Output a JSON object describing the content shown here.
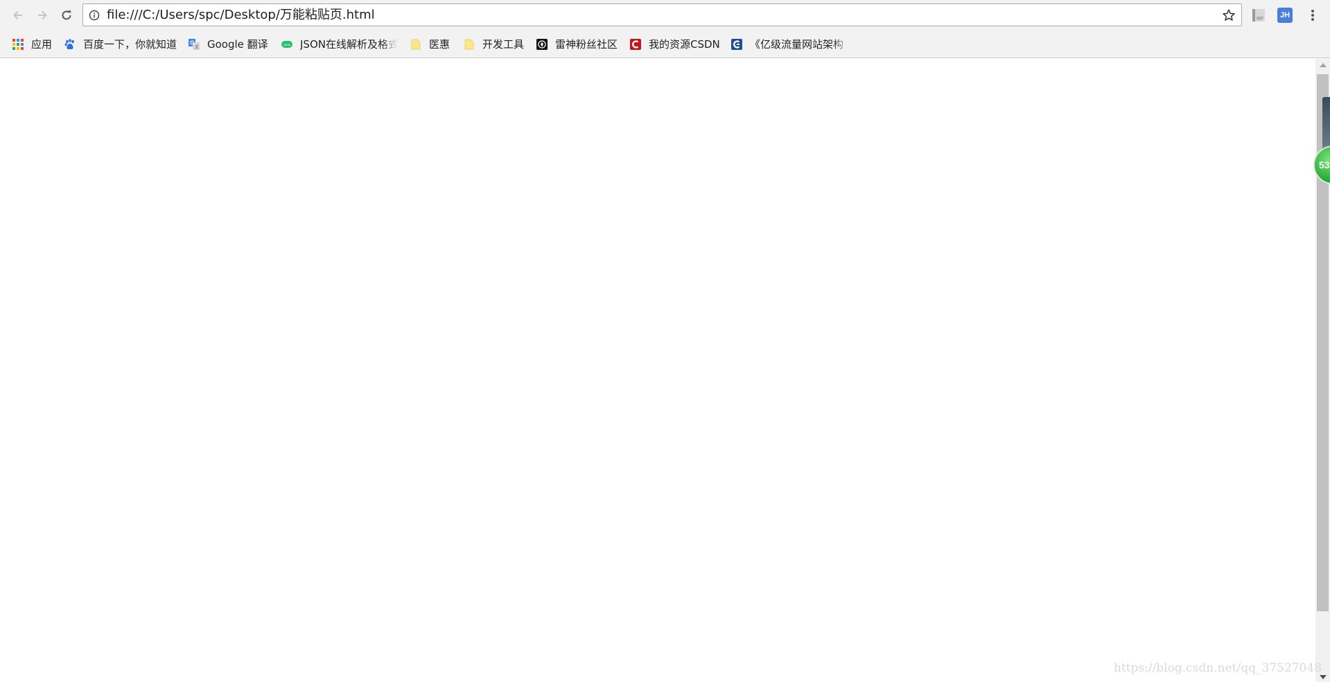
{
  "toolbar": {
    "address_url": "file:///C:/Users/spc/Desktop/万能粘贴页.html",
    "icons": {
      "back": "arrow-left-icon",
      "forward": "arrow-right-icon",
      "reload": "reload-icon",
      "site_info": "info-icon",
      "bookmark_star": "star-icon",
      "menu": "vertical-ellipsis-icon"
    }
  },
  "extensions": [
    {
      "name": "rp-extension-icon",
      "label": "RP"
    },
    {
      "name": "jh-extension-icon",
      "label": "JH"
    }
  ],
  "bookmarks": [
    {
      "label": "应用",
      "icon": "apps-grid-icon"
    },
    {
      "label": "百度一下，你就知道",
      "icon": "baidu-paw-icon"
    },
    {
      "label": "Google 翻译",
      "icon": "google-translate-icon"
    },
    {
      "label": "JSON在线解析及格式",
      "icon": "json-icon"
    },
    {
      "label": "医惠",
      "icon": "folder-icon"
    },
    {
      "label": "开发工具",
      "icon": "folder-icon"
    },
    {
      "label": "雷神粉丝社区",
      "icon": "leishen-icon"
    },
    {
      "label": "我的资源CSDN",
      "icon": "csdn-icon"
    },
    {
      "label": "《亿级流量网站架构",
      "icon": "c-logo-icon"
    }
  ],
  "float_widget": {
    "value": "53"
  },
  "watermark": "https://blog.csdn.net/qq_37527048",
  "colors": {
    "chrome_bg": "#f2f2f2",
    "content_bg": "#ffffff",
    "jh_badge": "#4a7fd9",
    "csdn_red": "#c4161c",
    "widget_green": "#2fae3a"
  }
}
